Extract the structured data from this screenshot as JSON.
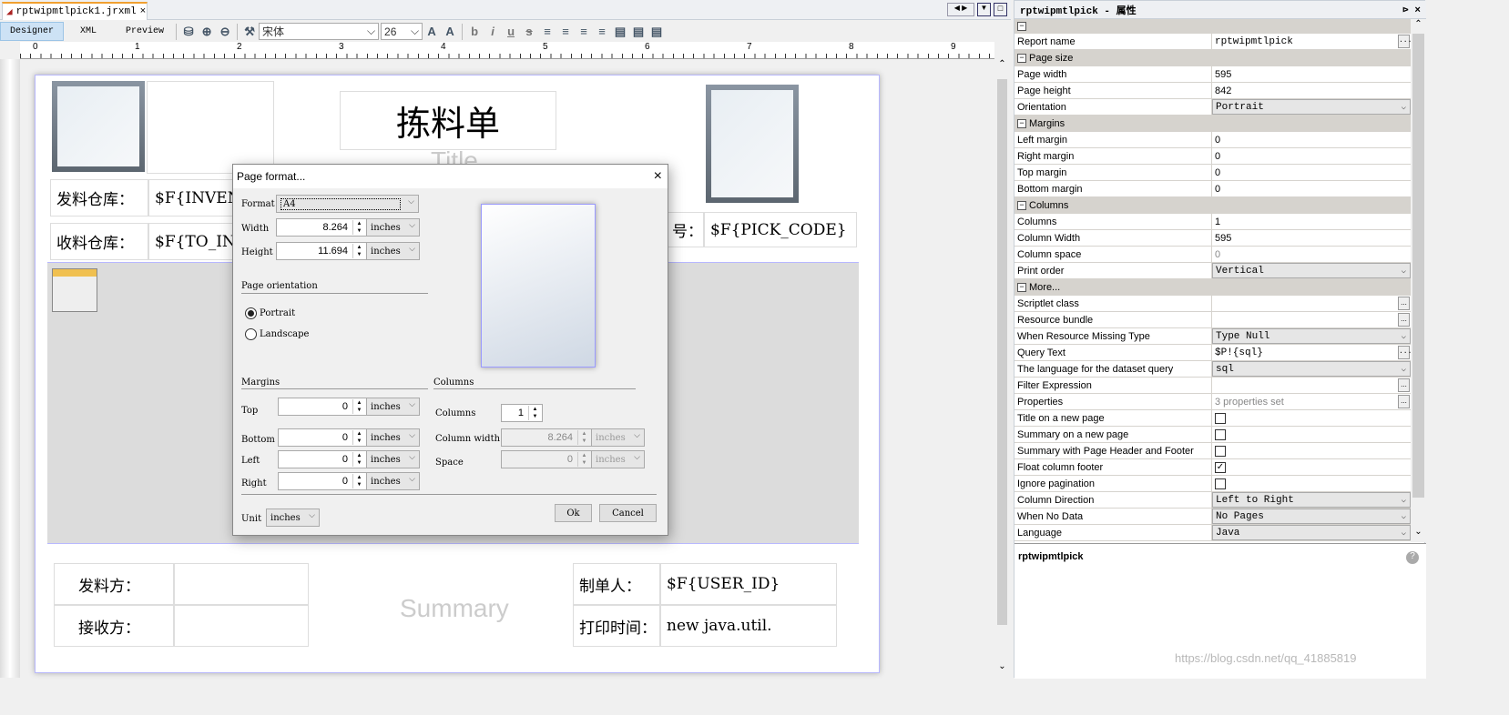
{
  "editor": {
    "file_tab": "rptwipmtlpick1.jrxml",
    "views": [
      "Designer",
      "XML",
      "Preview"
    ],
    "active_view": "Designer",
    "font_name": "宋体",
    "font_size": "26"
  },
  "ruler": {
    "h_ticks": [
      "0",
      "1",
      "2",
      "3",
      "4",
      "5",
      "6",
      "7",
      "8",
      "9"
    ]
  },
  "report": {
    "title_text": "拣料单",
    "title_band": "Title",
    "summary_band": "Summary",
    "fields": [
      {
        "label": "发料仓库：",
        "value": "$F{INVENTO"
      },
      {
        "label": "收料仓库：",
        "value": "$F{TO_INVE"
      },
      {
        "label": "号：",
        "value": "$F{PICK_CODE}"
      }
    ],
    "summary": [
      {
        "label": "发料方：",
        "value": ""
      },
      {
        "label": "接收方：",
        "value": ""
      },
      {
        "label": "制单人：",
        "value": "$F{USER_ID}"
      },
      {
        "label": "打印时间：",
        "value": "new java.util."
      }
    ]
  },
  "properties": {
    "title": "rptwipmtlpick - 属性",
    "rows": [
      {
        "label": "Report name",
        "value": "rptwipmtlpick",
        "kind": "ellipsis"
      },
      {
        "label": "Page size",
        "kind": "category"
      },
      {
        "label": "Page width",
        "value": "595"
      },
      {
        "label": "Page height",
        "value": "842"
      },
      {
        "label": "Orientation",
        "value": "Portrait",
        "kind": "dropdown"
      },
      {
        "label": "Margins",
        "kind": "category"
      },
      {
        "label": "Left margin",
        "value": "0"
      },
      {
        "label": "Right margin",
        "value": "0"
      },
      {
        "label": "Top margin",
        "value": "0"
      },
      {
        "label": "Bottom margin",
        "value": "0"
      },
      {
        "label": "Columns",
        "kind": "category"
      },
      {
        "label": "Columns",
        "value": "1"
      },
      {
        "label": "Column Width",
        "value": "595"
      },
      {
        "label": "Column space",
        "value": "0",
        "kind": "disabled"
      },
      {
        "label": "Print order",
        "value": "Vertical",
        "kind": "dropdown"
      },
      {
        "label": "More...",
        "kind": "category"
      },
      {
        "label": "Scriptlet class",
        "value": "",
        "kind": "ellipsis"
      },
      {
        "label": "Resource bundle",
        "value": "",
        "kind": "ellipsis"
      },
      {
        "label": "When Resource Missing Type",
        "value": "Type Null",
        "kind": "dropdown"
      },
      {
        "label": "Query Text",
        "value": "$P!{sql}",
        "kind": "ellipsis"
      },
      {
        "label": "The language for the dataset query",
        "value": "sql",
        "kind": "dropdown"
      },
      {
        "label": "Filter Expression",
        "value": "",
        "kind": "ellipsis"
      },
      {
        "label": "Properties",
        "value": "3 properties set",
        "kind": "ellipsis-gray"
      },
      {
        "label": "Title on a new page",
        "checked": false,
        "kind": "check"
      },
      {
        "label": "Summary on a new page",
        "checked": false,
        "kind": "check"
      },
      {
        "label": "Summary with Page Header and Footer",
        "checked": false,
        "kind": "check"
      },
      {
        "label": "Float column footer",
        "checked": true,
        "kind": "check"
      },
      {
        "label": "Ignore pagination",
        "checked": false,
        "kind": "check"
      },
      {
        "label": "Column Direction",
        "value": "Left to Right",
        "kind": "dropdown"
      },
      {
        "label": "When No Data",
        "value": "No Pages",
        "kind": "dropdown"
      },
      {
        "label": "Language",
        "value": "Java",
        "kind": "dropdown"
      }
    ],
    "description_title": "rptwipmtlpick"
  },
  "dialog": {
    "title": "Page format...",
    "format_label": "Format",
    "format_value": "A4",
    "width_label": "Width",
    "width_value": "8.264",
    "height_label": "Height",
    "height_value": "11.694",
    "unit_option": "inches",
    "orientation_title": "Page orientation",
    "portrait": "Portrait",
    "landscape": "Landscape",
    "orientation": "Portrait",
    "margins_title": "Margins",
    "top": "Top",
    "bottom": "Bottom",
    "left": "Left",
    "right": "Right",
    "margin_value": "0",
    "columns_title": "Columns",
    "columns_label": "Columns",
    "columns_value": "1",
    "colwidth_label": "Column width",
    "colwidth_value": "8.264",
    "space_label": "Space",
    "space_value": "0",
    "unit_label": "Unit",
    "unit_value": "inches",
    "ok": "Ok",
    "cancel": "Cancel"
  },
  "watermark": "https://blog.csdn.net/qq_41885819"
}
